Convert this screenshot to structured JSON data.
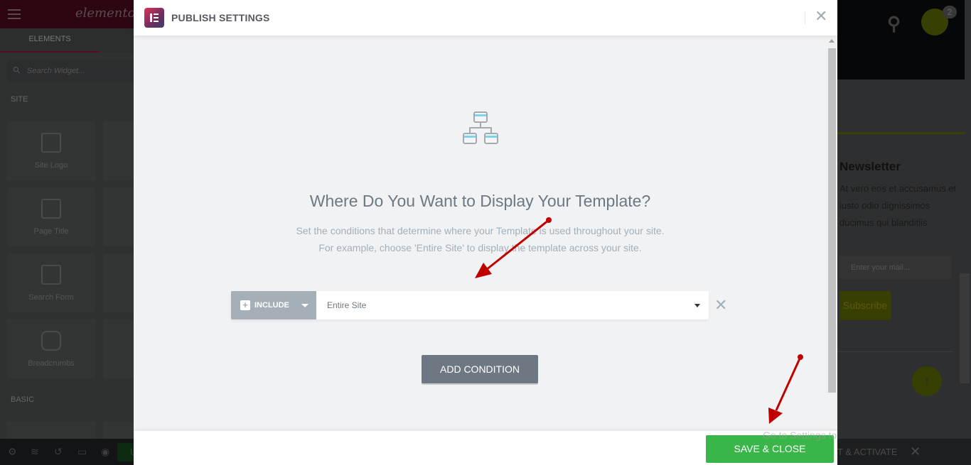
{
  "editor": {
    "logo_text": "elementor",
    "tab_elements": "ELEMENTS",
    "search_placeholder": "Search Widget...",
    "section_site": "SITE",
    "section_basic": "BASIC",
    "widgets": [
      "Site Logo",
      "Page Title",
      "Search Form",
      "Breadcrumbs"
    ],
    "publish_button_partial": "U"
  },
  "site_preview": {
    "cart_count": "2",
    "newsletter_title": "Newsletter",
    "newsletter_text": "At vero eos et accusamus et iusto odio dignissimos ducimus qui blanditiis",
    "email_placeholder": "Enter your mail...",
    "subscribe_label": "Subscribe",
    "bottom_bar_text": "T & ACTIVATE",
    "accent_color": "#3a4004"
  },
  "modal": {
    "title": "PUBLISH SETTINGS",
    "heading": "Where Do You Want to Display Your Template?",
    "description_line1": "Set the conditions that determine where your Template is used throughout your site.",
    "description_line2": "For example, choose 'Entire Site' to display the template across your site.",
    "condition": {
      "type": "INCLUDE",
      "value": "Entire Site"
    },
    "add_condition_label": "ADD CONDITION",
    "save_close_label": "SAVE & CLOSE",
    "save_color": "#39b54a"
  },
  "watermark": "Go to Settings to",
  "annotation_color": "#c00000"
}
